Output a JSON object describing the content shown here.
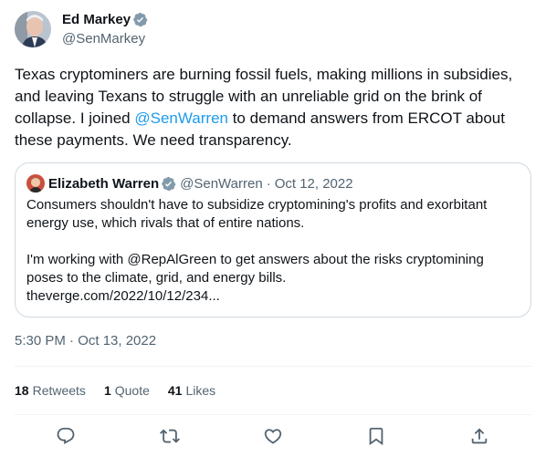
{
  "author": {
    "display_name": "Ed Markey",
    "handle": "@SenMarkey",
    "avatar_icon": "ed-markey-avatar",
    "verified_icon": "verified-badge-icon"
  },
  "tweet": {
    "text_before_mention": "Texas cryptominers are burning fossil fuels, making millions in subsidies, and leaving Texans to struggle with an unreliable grid on the brink of collapse. I joined ",
    "mention": "@SenWarren",
    "text_after_mention": " to demand answers from ERCOT about these payments. We need transparency.",
    "timestamp": "5:30 PM · Oct 13, 2022"
  },
  "quoted_tweet": {
    "display_name": "Elizabeth Warren",
    "handle": "@SenWarren",
    "separator": "·",
    "date": "Oct 12, 2022",
    "paragraph_1": "Consumers shouldn't have to subsidize cryptomining's profits and exorbitant energy use, which rivals that of entire nations.",
    "paragraph_2": "I'm working with @RepAlGreen to get answers about the risks cryptomining poses to the climate, grid, and energy bills.",
    "link": "theverge.com/2022/10/12/234..."
  },
  "stats": [
    {
      "count": "18",
      "label": "Retweets"
    },
    {
      "count": "1",
      "label": "Quote"
    },
    {
      "count": "41",
      "label": "Likes"
    }
  ],
  "actions": [
    "reply-icon",
    "retweet-icon",
    "like-icon",
    "bookmark-icon",
    "share-icon"
  ],
  "colors": {
    "text": "#0f1419",
    "secondary": "#536471",
    "link": "#1d9bf0",
    "border": "#cfd9de",
    "divider": "#eff3f4"
  }
}
